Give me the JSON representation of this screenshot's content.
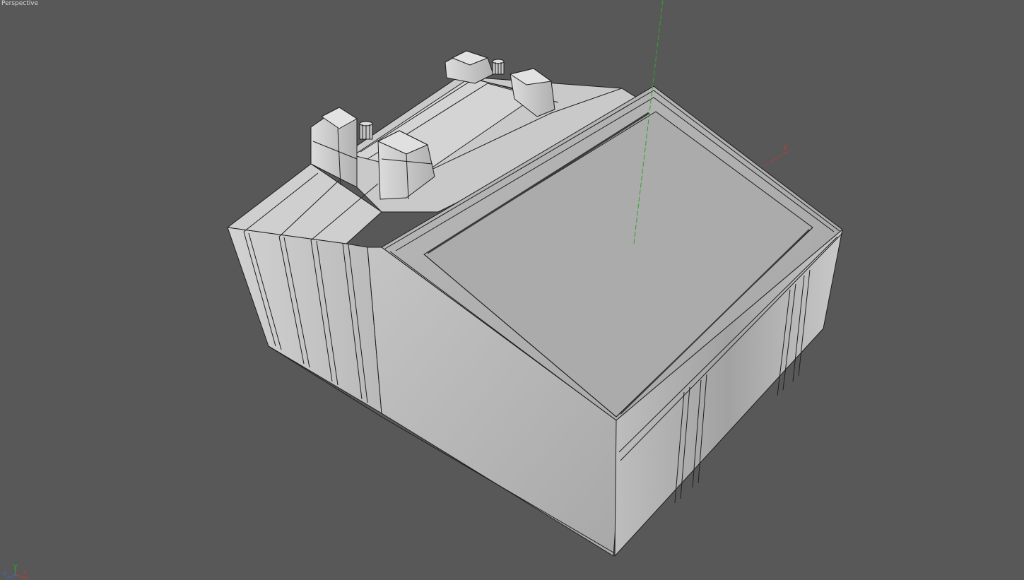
{
  "viewport": {
    "name": "Perspective",
    "background": "#585858"
  },
  "axis_tripod": {
    "x_label": "x",
    "y_label": "y",
    "z_label": "z"
  },
  "gizmo": {
    "x_label": "X",
    "x_color": "#c83a2e",
    "y_color": "#2fa52f"
  },
  "colors": {
    "mesh_light": "#d6d6d6",
    "mesh_mid": "#bdbdbd",
    "mesh_dark": "#a9a9a9",
    "edge": "#1e1e1e"
  }
}
